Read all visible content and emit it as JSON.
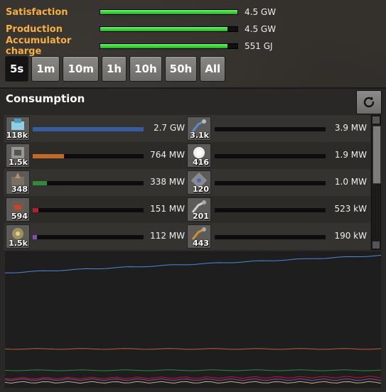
{
  "stats": [
    {
      "label": "Satisfaction",
      "value": "4.5 GW",
      "fill": 1.0
    },
    {
      "label": "Production",
      "value": "4.5 GW",
      "fill": 0.93
    },
    {
      "label": "Accumulator charge",
      "value": "551 GJ",
      "fill": 0.93
    }
  ],
  "time_buttons": [
    "5s",
    "1m",
    "10m",
    "1h",
    "10h",
    "50h",
    "All"
  ],
  "active_time": "5s",
  "panel": {
    "title": "Consumption"
  },
  "entries": [
    {
      "count": "118k",
      "value": "2.7 GW",
      "fill": 1.0,
      "color": "#3a5a9e",
      "icon": "lab-icon"
    },
    {
      "count": "3.1k",
      "value": "3.9 MW",
      "fill": 0.0,
      "color": "#5a7ab8",
      "icon": "inserter-icon"
    },
    {
      "count": "1.5k",
      "value": "764 MW",
      "fill": 0.28,
      "color": "#c06a2a",
      "icon": "assembler-icon"
    },
    {
      "count": "416",
      "value": "1.9 MW",
      "fill": 0.0,
      "color": "#888",
      "icon": "lamp-icon"
    },
    {
      "count": "348",
      "value": "338 MW",
      "fill": 0.13,
      "color": "#2f8a3a",
      "icon": "drill-icon"
    },
    {
      "count": "120",
      "value": "1.0 MW",
      "fill": 0.0,
      "color": "#888",
      "icon": "roboport-icon"
    },
    {
      "count": "594",
      "value": "151 MW",
      "fill": 0.05,
      "color": "#b0202a",
      "icon": "furnace-icon"
    },
    {
      "count": "201",
      "value": "523 kW",
      "fill": 0.0,
      "color": "#888",
      "icon": "filter-inserter-icon"
    },
    {
      "count": "1.5k",
      "value": "112 MW",
      "fill": 0.04,
      "color": "#8a4ab0",
      "icon": "beacon-icon"
    },
    {
      "count": "443",
      "value": "190 kW",
      "fill": 0.0,
      "color": "#c08a2a",
      "icon": "long-inserter-icon"
    }
  ],
  "graph": {
    "series": [
      {
        "color": "#4a8ad8",
        "start": 0.85,
        "end": 0.98
      },
      {
        "color": "#c0602a",
        "start": 0.28,
        "end": 0.28
      },
      {
        "color": "#2f8a3a",
        "start": 0.12,
        "end": 0.12
      },
      {
        "color": "#b0202a",
        "start": 0.06,
        "end": 0.07
      },
      {
        "color": "#8a4ab0",
        "start": 0.05,
        "end": 0.05
      },
      {
        "color": "#c0b080",
        "start": 0.03,
        "end": 0.03
      }
    ]
  }
}
